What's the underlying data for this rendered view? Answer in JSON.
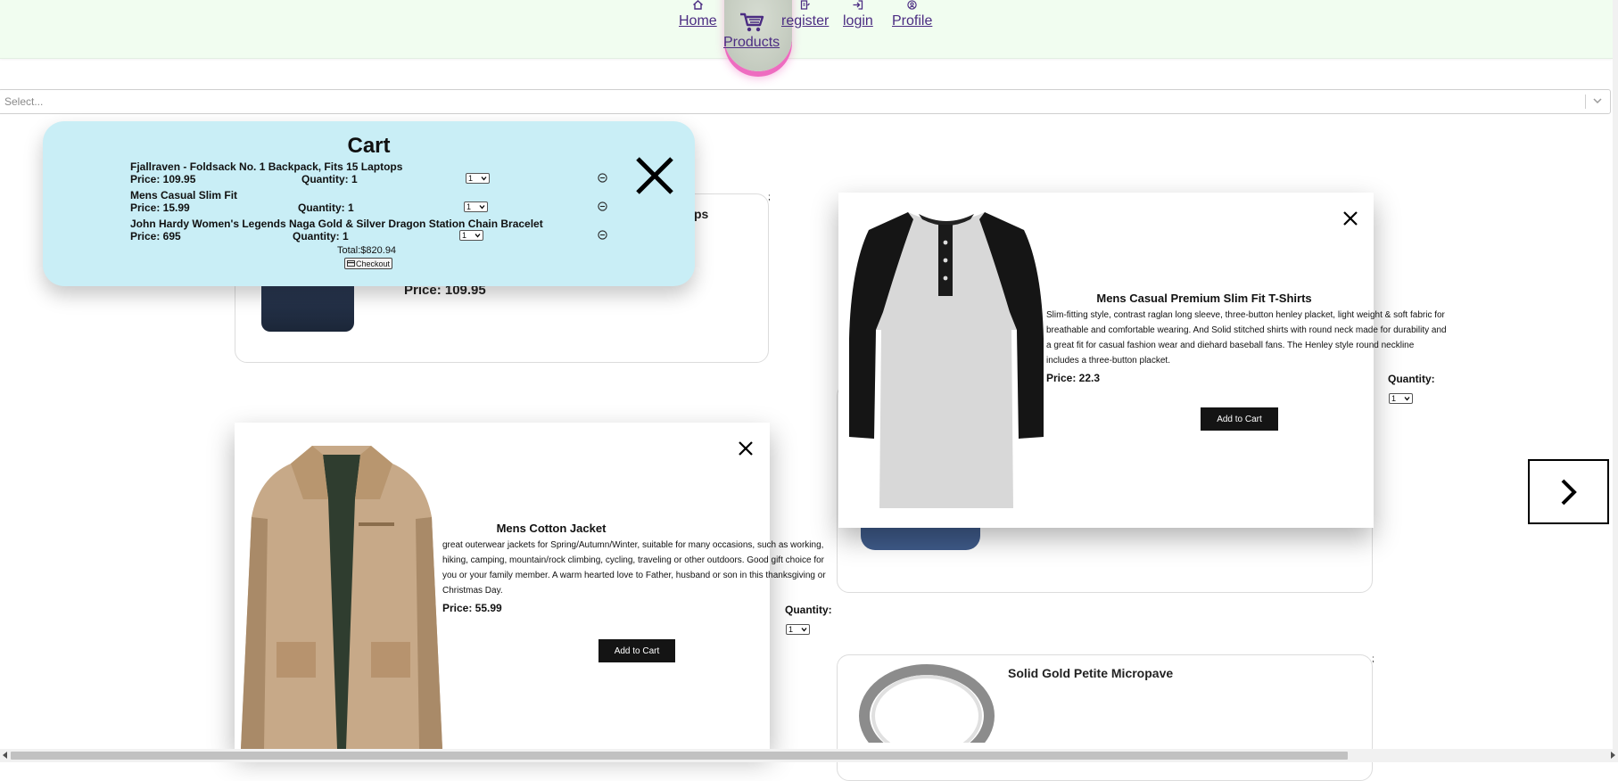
{
  "nav": {
    "home": "Home",
    "products": "Products",
    "register": "register",
    "login": "login",
    "profile": "Profile"
  },
  "filter": {
    "placeholder": "Select..."
  },
  "cards": {
    "backpack_title_fragment": "ps",
    "backpack_price": "Price: 109.95",
    "ring_title": "Solid Gold Petite Micropave",
    "colon": ";"
  },
  "tshirt_modal": {
    "title": "Mens Casual Premium Slim Fit T-Shirts",
    "description": "Slim-fitting style, contrast raglan long sleeve, three-button henley placket, light weight & soft fabric for breathable and comfortable wearing. And Solid stitched shirts with round neck made for durability and a great fit for casual fashion wear and diehard baseball fans. The Henley style round neckline includes a three-button placket.",
    "price": "Price: 22.3",
    "quantity_label": "Quantity:",
    "quantity_value": "1",
    "add_button": "Add to Cart"
  },
  "jacket_modal": {
    "title": "Mens Cotton Jacket",
    "description": "great outerwear jackets for Spring/Autumn/Winter, suitable for many occasions, such as working, hiking, camping, mountain/rock climbing, cycling, traveling or other outdoors. Good gift choice for you or your family member. A warm hearted love to Father, husband or son in this thanksgiving or Christmas Day.",
    "price": "Price: 55.99",
    "quantity_label": "Quantity:",
    "quantity_value": "1",
    "add_button": "Add to Cart"
  },
  "cart": {
    "title": "Cart",
    "items": [
      {
        "name": "Fjallraven - Foldsack No. 1 Backpack, Fits 15 Laptops",
        "price": "Price: 109.95",
        "quantity": "Quantity: 1",
        "select": "1"
      },
      {
        "name": "Mens Casual Slim Fit",
        "price": "Price: 15.99",
        "quantity": "Quantity: 1",
        "select": "1"
      },
      {
        "name": "John Hardy Women's Legends Naga Gold & Silver Dragon Station Chain Bracelet",
        "price": "Price: 695",
        "quantity": "Quantity: 1",
        "select": "1"
      }
    ],
    "total": "Total:$820.94",
    "checkout": "Checkout"
  },
  "icons": {
    "home": "home-icon",
    "cart": "cart-icon",
    "register": "register-icon",
    "login": "login-icon",
    "profile": "profile-icon",
    "close": "close-icon",
    "remove": "minus-circle-icon",
    "next": "chevron-right-icon",
    "checkout": "credit-card-icon"
  },
  "colors": {
    "nav_bg": "#f1fdf0",
    "nav_link": "#4b2c82",
    "cart_bg": "#c9eef6",
    "button_bg": "#141414",
    "active_glow": "#ee6cc0"
  }
}
